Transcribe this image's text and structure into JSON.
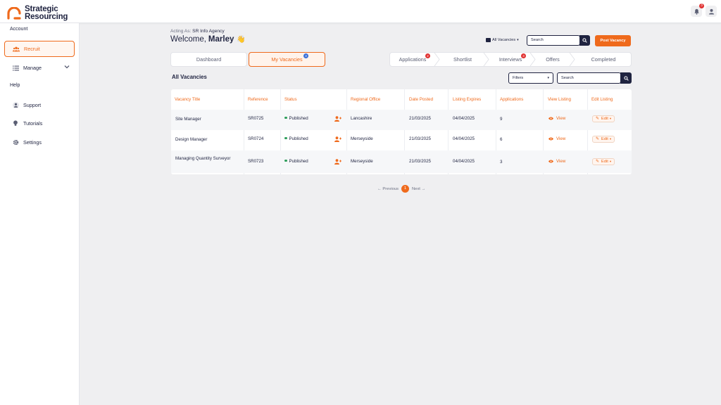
{
  "brand": {
    "name_line1": "Strategic",
    "name_line2": "Resourcing",
    "accent": "#ef6a1c",
    "navy": "#1f2340"
  },
  "topbar": {
    "notifications_count": "3",
    "bell_icon": "bell-icon",
    "user_icon": "user-icon"
  },
  "sidebar": {
    "account_heading": "Account",
    "help_heading": "Help",
    "items": [
      {
        "label": "Recruit",
        "icon": "users-icon",
        "active": true
      },
      {
        "label": "Manage",
        "icon": "list-icon",
        "active": false
      },
      {
        "label": "Support",
        "icon": "person-icon",
        "active": false
      },
      {
        "label": "Tutorials",
        "icon": "lightbulb-icon",
        "active": false
      },
      {
        "label": "Settings",
        "icon": "gear-icon",
        "active": false
      }
    ]
  },
  "header": {
    "acting_as_label": "Acting As:",
    "acting_as_value": "SR Info Agency",
    "welcome": "Welcome,",
    "user_name": "Marley",
    "wave": "👋",
    "vacancy_filter": "All Vacancies",
    "search_placeholder": "Search",
    "post_button": "Post Vacancy"
  },
  "tabs": [
    {
      "label": "Dashboard",
      "badge": ""
    },
    {
      "label": "My Vacancies",
      "badge": "3"
    }
  ],
  "pipeline": [
    {
      "label": "Applications",
      "badge": "2"
    },
    {
      "label": "Shortlist",
      "badge": ""
    },
    {
      "label": "Interviews",
      "badge": "3"
    },
    {
      "label": "Offers",
      "badge": ""
    },
    {
      "label": "Completed",
      "badge": ""
    }
  ],
  "list": {
    "title": "All Vacancies",
    "filters_label": "Filters",
    "search_placeholder": "Search",
    "columns": [
      "Vacancy Title",
      "Reference",
      "Status",
      "Regional Office",
      "Date Posted",
      "Listing Expires",
      "Applications",
      "View Listing",
      "Edit Listing"
    ],
    "rows": [
      {
        "title": "Site Manager",
        "reference": "SR0725",
        "status": "Published",
        "office": "Lancashire",
        "posted": "21/03/2025",
        "expires": "04/04/2025",
        "applications": "9",
        "view": "View",
        "edit": "Edit"
      },
      {
        "title": "Design Manager",
        "reference": "SR0724",
        "status": "Published",
        "office": "Merseyside",
        "posted": "21/03/2025",
        "expires": "04/04/2025",
        "applications": "6",
        "view": "View",
        "edit": "Edit"
      },
      {
        "title": "Managing Quantity Surveyor",
        "reference": "SR0723",
        "status": "Published",
        "office": "Merseyside",
        "posted": "21/03/2025",
        "expires": "04/04/2025",
        "applications": "3",
        "view": "View",
        "edit": "Edit"
      }
    ]
  },
  "pagination": {
    "previous": "Previous",
    "current": "1",
    "next": "Next"
  }
}
